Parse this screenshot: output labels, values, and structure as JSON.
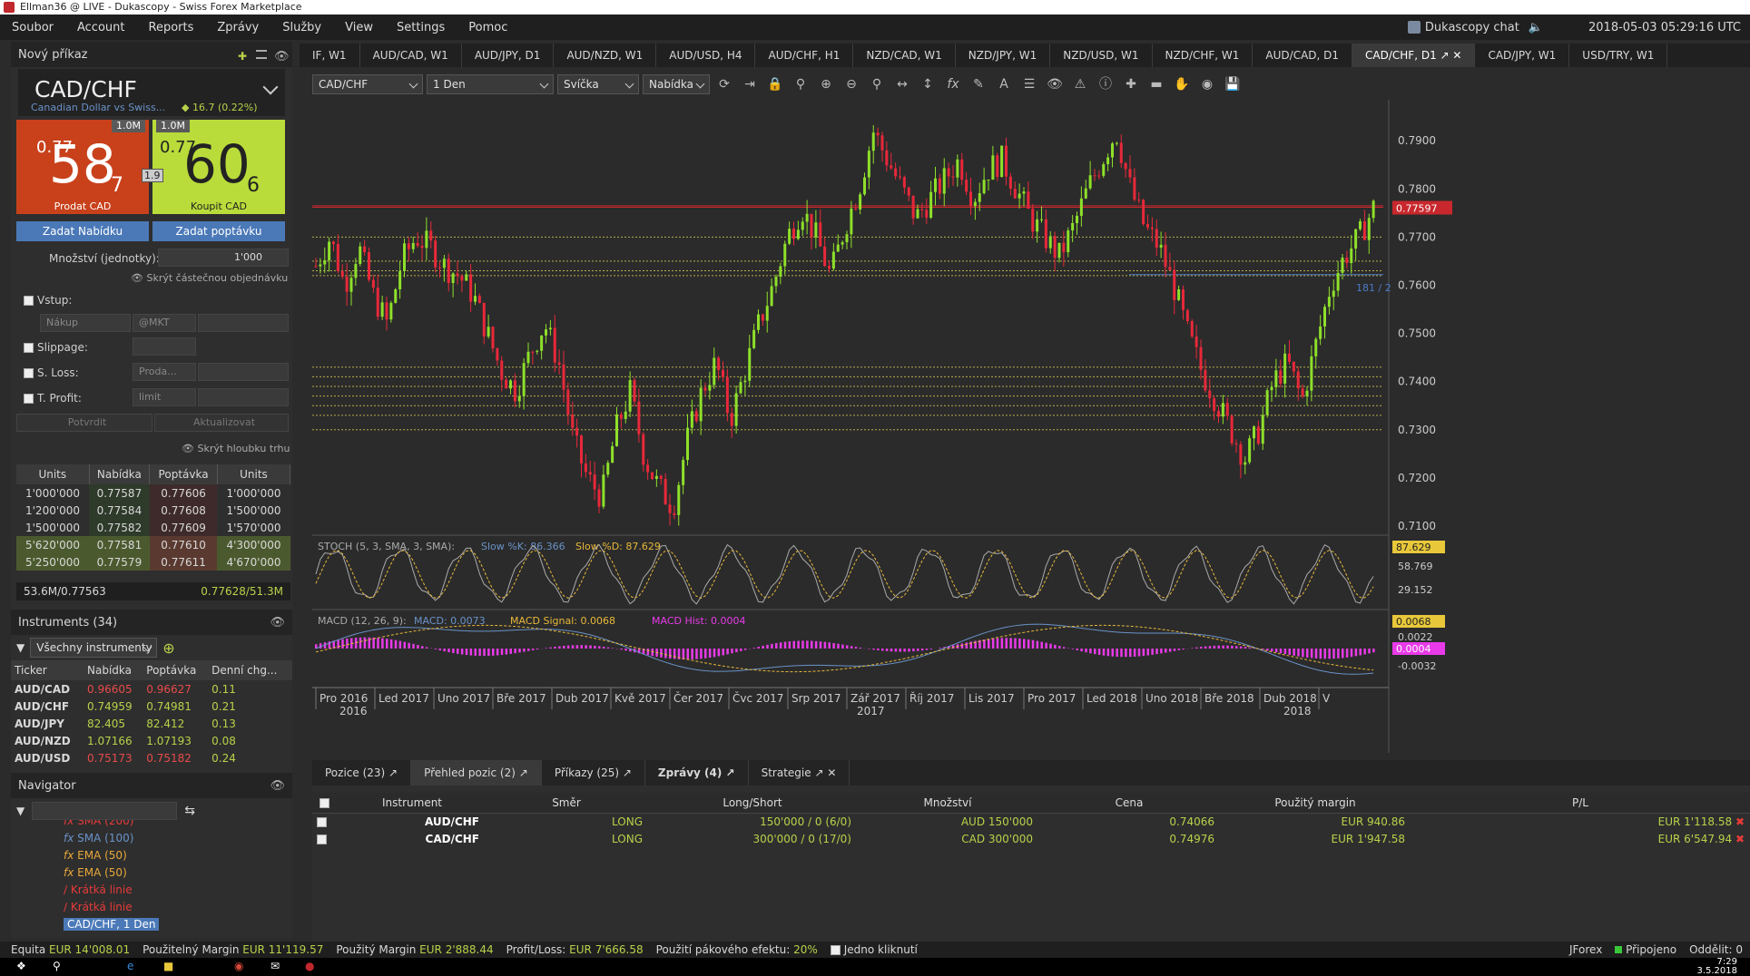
{
  "window": {
    "title": "Ellman36 @ LIVE - Dukascopy - Swiss Forex Marketplace"
  },
  "menu": {
    "items": [
      "Soubor",
      "Account",
      "Reports",
      "Zprávy",
      "Služby",
      "View",
      "Settings",
      "Pomoc"
    ],
    "chat": "Dukascopy chat",
    "clock": "2018-05-03 05:29:16 UTC"
  },
  "order": {
    "title": "Nový příkaz",
    "symbol": "CAD/CHF",
    "description": "Canadian Dollar vs Swiss...",
    "change": "16.7 (0.22%)",
    "sell": {
      "prefix": "0.77",
      "big": "58",
      "pip": "7",
      "label": "Prodat CAD",
      "volume": "1.0M"
    },
    "buy": {
      "prefix": "0.77",
      "big": "60",
      "pip": "6",
      "label": "Koupit CAD",
      "volume": "1.0M"
    },
    "spread": "1.9",
    "bid_button": "Zadat Nabídku",
    "ask_button": "Zadat poptávku",
    "amount_label": "Množství (jednotky):",
    "amount": "1'000",
    "hide_partial": "Skrýt částečnou objednávku",
    "entry": "Vstup:",
    "entry_side": "Nákup",
    "entry_price": "@MKT",
    "slippage": "Slippage:",
    "stop_loss": "S. Loss:",
    "sl_placeholder": "Proda...",
    "take_profit": "T. Profit:",
    "tp_placeholder": "limit",
    "confirm": "Potvrdit",
    "update": "Aktualizovat",
    "hide_depth": "Skrýt hloubku trhu"
  },
  "depth": {
    "headers": [
      "Units",
      "Nabídka",
      "Poptávka",
      "Units"
    ],
    "rows": [
      [
        "1'000'000",
        "0.77587",
        "0.77606",
        "1'000'000"
      ],
      [
        "1'200'000",
        "0.77584",
        "0.77608",
        "1'500'000"
      ],
      [
        "1'500'000",
        "0.77582",
        "0.77609",
        "1'570'000"
      ],
      [
        "5'620'000",
        "0.77581",
        "0.77610",
        "4'300'000"
      ],
      [
        "5'250'000",
        "0.77579",
        "0.77611",
        "4'670'000"
      ]
    ],
    "total_bid": "53.6M/0.77563",
    "total_ask": "0.77628/51.3M"
  },
  "instruments": {
    "title": "Instruments (34)",
    "filter": "Všechny instrumenty",
    "headers": [
      "Ticker",
      "Nabídka",
      "Poptávka",
      "Denní chg..."
    ],
    "rows": [
      [
        "AUD/CAD",
        "0.96605",
        "0.96627",
        "0.11"
      ],
      [
        "AUD/CHF",
        "0.74959",
        "0.74981",
        "0.21"
      ],
      [
        "AUD/JPY",
        "82.405",
        "82.412",
        "0.13"
      ],
      [
        "AUD/NZD",
        "1.07166",
        "1.07193",
        "0.08"
      ],
      [
        "AUD/USD",
        "0.75173",
        "0.75182",
        "0.24"
      ]
    ]
  },
  "navigator": {
    "title": "Navigator",
    "items": [
      "SMA (200)",
      "SMA (100)",
      "EMA (50)",
      "EMA (50)",
      "Krátká linie",
      "Krátká linie"
    ],
    "selected": "CAD/CHF, 1 Den"
  },
  "chart_tabs": [
    "IF, W1",
    "AUD/CAD, W1",
    "AUD/JPY, D1",
    "AUD/NZD, W1",
    "AUD/USD, H4",
    "AUD/CHF, H1",
    "NZD/CAD, W1",
    "NZD/JPY, W1",
    "NZD/USD, W1",
    "NZD/CHF, W1",
    "AUD/CAD, D1",
    "CAD/CHF, D1",
    "CAD/JPY, W1",
    "USD/TRY, W1"
  ],
  "active_tab": "CAD/CHF, D1",
  "toolbar": {
    "instrument": "CAD/CHF",
    "period": "1 Den",
    "type": "Svíčka",
    "side": "Nabídka"
  },
  "chart_data": {
    "type": "candlestick",
    "instrument": "CAD/CHF",
    "period": "1 Den",
    "price_ticks": [
      "0.7900",
      "0.7800",
      "0.7700",
      "0.7600",
      "0.7500",
      "0.7400",
      "0.7300",
      "0.7200",
      "0.7100"
    ],
    "current_price": "0.77597",
    "stoch": {
      "label": "STOCH (5, 3, SMA, 3, SMA):",
      "k_label": "Slow %K: 86.366",
      "d_label": "Slow %D: 87.629",
      "d_value": "87.629",
      "ticks": [
        "58.769",
        "29.152"
      ]
    },
    "macd": {
      "label": "MACD (12, 26, 9):",
      "macd_label": "MACD: 0.0073",
      "signal_label": "MACD Signal: 0.0068",
      "hist_label": "MACD Hist: 0.0004",
      "signal_value": "0.0068",
      "hist_value": "0.0004",
      "ticks": [
        "0.0022",
        "-0.0032"
      ]
    },
    "months": [
      "Pro 2016",
      "Led 2017",
      "Uno 2017",
      "Bře 2017",
      "Dub 2017",
      "Kvě 2017",
      "Čer 2017",
      "Čvc 2017",
      "Srp 2017",
      "Zář 2017",
      "Říj 2017",
      "Lis 2017",
      "Pro 2017",
      "Led 2018",
      "Uno 2018",
      "Bře 2018",
      "Dub 2018",
      "V"
    ],
    "years": [
      "2016",
      "2017",
      "2018"
    ],
    "line_label": "181 / 2"
  },
  "bottom": {
    "tabs": [
      "Pozice (23)",
      "Přehled pozic (2)",
      "Příkazy (25)",
      "Zprávy (4)",
      "Strategie"
    ],
    "headers": [
      "Instrument",
      "Směr",
      "Long/Short",
      "Množství",
      "Cena",
      "Použitý margin",
      "P/L"
    ],
    "rows": [
      [
        "AUD/CHF",
        "LONG",
        "150'000 / 0 (6/0)",
        "AUD 150'000",
        "0.74066",
        "EUR 940.86",
        "EUR 1'118.58"
      ],
      [
        "CAD/CHF",
        "LONG",
        "300'000 / 0 (17/0)",
        "CAD 300'000",
        "0.74976",
        "EUR 1'947.58",
        "EUR 6'547.94"
      ]
    ]
  },
  "status": {
    "equity_label": "Equita",
    "equity": "EUR 14'008.01",
    "used_margin_label": "Použitelný Margin",
    "used_margin": "EUR 11'119.57",
    "margin_label": "Použitý Margin",
    "margin": "EUR 2'888.44",
    "pl_label": "Profit/Loss:",
    "pl": "EUR 7'666.58",
    "leverage_label": "Použití pákového efektu:",
    "leverage": "20%",
    "one_click": "Jedno kliknutí",
    "platform": "JForex",
    "connected": "Připojeno",
    "disconnect": "Oddělit: 0"
  },
  "taskbar": {
    "time": "7:29",
    "date": "3.5.2018"
  }
}
